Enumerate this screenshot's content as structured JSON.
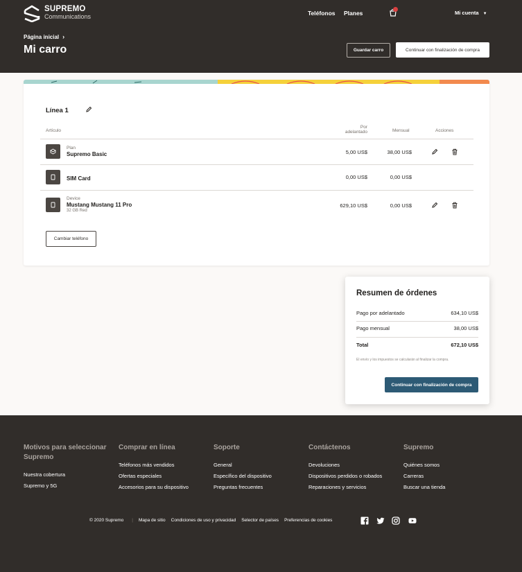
{
  "header": {
    "brand": "SUPREMO",
    "brand_sub": "Communications",
    "nav": [
      "Teléfonos",
      "Planes"
    ],
    "account": "Mi cuenta",
    "breadcrumb": "Página inicial",
    "title": "Mi carro",
    "save_label": "Guardar carro",
    "checkout_label": "Continuar con finalización de compra"
  },
  "cart": {
    "line_title": "Línea 1",
    "columns": {
      "article": "Artículo",
      "upfront": "Por adelantado",
      "monthly": "Mensual",
      "actions": "Acciones"
    },
    "items": [
      {
        "type": "Plan",
        "name": "Supremo Basic",
        "sub": "",
        "upfront": "5,00 US$",
        "monthly": "38,00 US$",
        "icon": "plan-icon",
        "actions": true
      },
      {
        "type": "",
        "name": "SIM Card",
        "sub": "",
        "upfront": "0,00 US$",
        "monthly": "0,00 US$",
        "icon": "sim-icon",
        "actions": false
      },
      {
        "type": "Device",
        "name": "Mustang Mustang 11 Pro",
        "sub": "32 GB Red",
        "upfront": "629,10 US$",
        "monthly": "0,00 US$",
        "icon": "phone-icon",
        "actions": true
      }
    ],
    "change_phone_label": "Cambiar teléfono"
  },
  "summary": {
    "title": "Resumen de órdenes",
    "upfront_label": "Pago por adelantado",
    "upfront_value": "634,10 US$",
    "monthly_label": "Pago mensual",
    "monthly_value": "38,00 US$",
    "total_label": "Total",
    "total_value": "672,10 US$",
    "note": "El envío y los impuestos se calcularán al finalizar la compra.",
    "checkout_label": "Continuar con finalización de compra"
  },
  "footer": {
    "columns": [
      {
        "title": "Motivos para seleccionar Supremo",
        "links": [
          "Nuestra cobertura",
          "Supremo y 5G"
        ]
      },
      {
        "title": "Comprar en línea",
        "links": [
          "Teléfonos más vendidos",
          "Ofertas especiales",
          "Accesorios para su dispositivo"
        ]
      },
      {
        "title": "Soporte",
        "links": [
          "General",
          "Específico del dispositivo",
          "Preguntas frecuentes"
        ]
      },
      {
        "title": "Contáctenos",
        "links": [
          "Devoluciones",
          "Dispositivos perdidos o robados",
          "Reparaciones y servicios"
        ]
      },
      {
        "title": "Supremo",
        "links": [
          "Quiénes somos",
          "Carreras",
          "Buscar una tienda"
        ]
      }
    ],
    "copyright": "© 2020 Supremo",
    "bottom_links": [
      "Mapa de sitio",
      "Condiciones de uso y privacidad",
      "Selector de países",
      "Preferencias de cookies"
    ],
    "social": [
      "facebook-icon",
      "twitter-icon",
      "instagram-icon",
      "youtube-icon"
    ]
  },
  "colors": {
    "header_bg": "#312d2a",
    "accent_button": "#2d5a75",
    "notification_dot": "#d94040"
  }
}
